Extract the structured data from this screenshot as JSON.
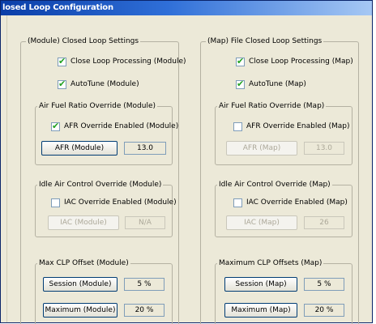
{
  "window": {
    "title": "losed Loop Configuration"
  },
  "colors": {
    "titlebar": "#0a3ea8",
    "checkmark": "#21a121",
    "disabled_text": "#aca899"
  },
  "module": {
    "group_title": "(Module) Closed Loop Settings",
    "close_loop": {
      "label": "Close Loop Processing (Module)",
      "checked": true
    },
    "autotune": {
      "label": "AutoTune (Module)",
      "checked": true
    },
    "afr": {
      "group_title": "Air Fuel Ratio Override (Module)",
      "enabled": {
        "label": "AFR Override Enabled (Module)",
        "checked": true
      },
      "button": "AFR (Module)",
      "value": "13.0"
    },
    "iac": {
      "group_title": "Idle Air Control Override (Module)",
      "enabled": {
        "label": "IAC Override Enabled (Module)",
        "checked": false
      },
      "button": "IAC (Module)",
      "value": "N/A"
    },
    "clp": {
      "group_title": "Max CLP Offset (Module)",
      "session_button": "Session (Module)",
      "session_value": "5 %",
      "maximum_button": "Maximum (Module)",
      "maximum_value": "20 %"
    }
  },
  "map": {
    "group_title": "(Map) File Closed Loop Settings",
    "close_loop": {
      "label": "Close Loop Processing (Map)",
      "checked": true
    },
    "autotune": {
      "label": "AutoTune (Map)",
      "checked": true
    },
    "afr": {
      "group_title": "Air Fuel Ratio Override (Map)",
      "enabled": {
        "label": "AFR Override Enabled (Map)",
        "checked": false
      },
      "button": "AFR (Map)",
      "value": "13.0"
    },
    "iac": {
      "group_title": "Idle Air Control Override (Map)",
      "enabled": {
        "label": "IAC Override Enabled (Map)",
        "checked": false
      },
      "button": "IAC (Map)",
      "value": "26"
    },
    "clp": {
      "group_title": "Maximum CLP Offsets (Map)",
      "session_button": "Session (Map)",
      "session_value": "5 %",
      "maximum_button": "Maximum (Map)",
      "maximum_value": "20 %"
    }
  }
}
